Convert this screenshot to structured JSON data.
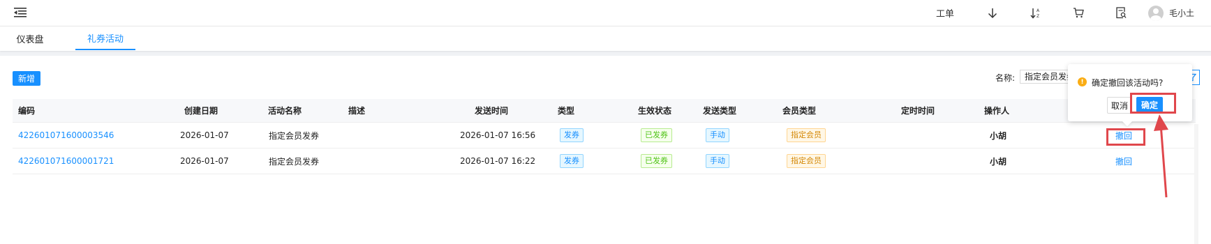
{
  "topbar": {
    "work_order_label": "工单",
    "user_name": "毛小土",
    "icons": [
      "menu-fold-icon",
      "download-arrow-icon",
      "sort-az-icon",
      "cart-icon",
      "doc-search-icon",
      "user-avatar-icon"
    ]
  },
  "tabs": [
    {
      "label": "仪表盘",
      "active": false
    },
    {
      "label": "礼券活动",
      "active": true
    }
  ],
  "toolbar": {
    "add_label": "新增",
    "filter_label": "名称:",
    "filter_value": "指定会员发券"
  },
  "table": {
    "headers": [
      "编码",
      "创建日期",
      "活动名称",
      "描述",
      "发送时间",
      "类型",
      "生效状态",
      "发送类型",
      "会员类型",
      "定时时间",
      "操作人"
    ],
    "rows": [
      {
        "code": "422601071600003546",
        "created": "2026-01-07",
        "name": "指定会员发券",
        "desc": "",
        "send_time": "2026-01-07 16:56",
        "type": "发券",
        "status": "已发券",
        "send_type": "手动",
        "member_type": "指定会员",
        "scheduled": "",
        "operator": "小胡",
        "action": "撤回"
      },
      {
        "code": "422601071600001721",
        "created": "2026-01-07",
        "name": "指定会员发券",
        "desc": "",
        "send_time": "2026-01-07 16:22",
        "type": "发券",
        "status": "已发券",
        "send_type": "手动",
        "member_type": "指定会员",
        "scheduled": "",
        "operator": "小胡",
        "action": "撤回"
      }
    ]
  },
  "popconfirm": {
    "message": "确定撤回该活动吗?",
    "cancel_label": "取消",
    "ok_label": "确定"
  },
  "colors": {
    "primary": "#1890ff",
    "highlight": "#e0474c",
    "warning": "#faad14"
  }
}
